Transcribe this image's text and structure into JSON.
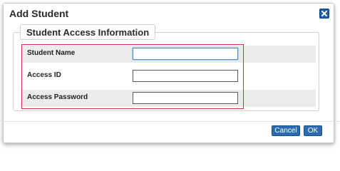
{
  "dialog": {
    "title": "Add Student",
    "close_icon": "close-icon"
  },
  "section": {
    "legend": "Student Access Information"
  },
  "fields": [
    {
      "label": "Student Name",
      "value": "",
      "placeholder": ""
    },
    {
      "label": "Access ID",
      "value": "",
      "placeholder": ""
    },
    {
      "label": "Access Password",
      "value": "",
      "placeholder": ""
    }
  ],
  "buttons": {
    "cancel": "Cancel",
    "ok": "OK"
  },
  "colors": {
    "button": "#2b6cb0",
    "highlight": "#c0393b",
    "row_shade": "#ececec"
  }
}
